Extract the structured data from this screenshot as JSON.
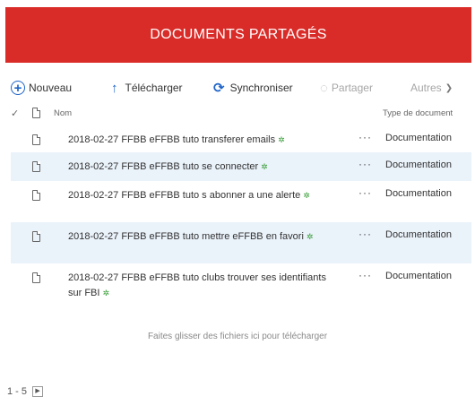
{
  "header": {
    "title": "DOCUMENTS PARTAGÉS",
    "bg_color": "#d92b27"
  },
  "toolbar": {
    "nouveau_label": "Nouveau",
    "telecharger_label": "Télécharger",
    "synchroniser_label": "Synchroniser",
    "partager_label": "Partager",
    "autres_label": "Autres",
    "accent_color": "#1e64c8"
  },
  "columns": {
    "name": "Nom",
    "type": "Type de document"
  },
  "documents": [
    {
      "name": "2018-02-27 FFBB eFFBB tuto transferer emails",
      "type": "Documentation",
      "more": "···"
    },
    {
      "name": "2018-02-27 FFBB eFFBB tuto se connecter",
      "type": "Documentation",
      "more": "···"
    },
    {
      "name": "2018-02-27 FFBB eFFBB tuto s abonner a une alerte",
      "type": "Documentation",
      "more": "···"
    },
    {
      "name": "2018-02-27 FFBB eFFBB tuto mettre eFFBB en favori",
      "type": "Documentation",
      "more": "···"
    },
    {
      "name": "2018-02-27 FFBB eFFBB tuto clubs trouver ses identifiants sur FBI",
      "type": "Documentation",
      "more": "···"
    }
  ],
  "drop_hint": "Faites glisser des fichiers ici pour télécharger",
  "pager": {
    "range": "1 - 5"
  }
}
